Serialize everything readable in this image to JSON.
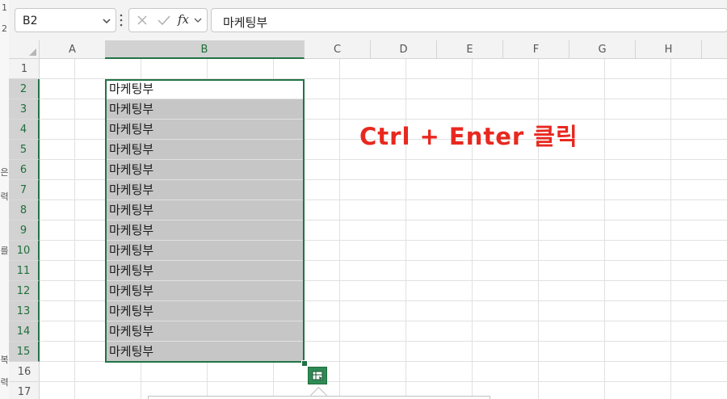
{
  "left_strip": {
    "chars": [
      "1",
      "2",
      "은",
      "력",
      "를",
      "복",
      "력"
    ]
  },
  "formula_bar": {
    "name_box_value": "B2",
    "fx_label": "fx",
    "formula_value": "마케팅부"
  },
  "sheet": {
    "columns": [
      "A",
      "B",
      "C",
      "D",
      "E",
      "F",
      "G",
      "H"
    ],
    "selected_column": "B",
    "rows": [
      "1",
      "2",
      "3",
      "4",
      "5",
      "6",
      "7",
      "8",
      "9",
      "10",
      "11",
      "12",
      "13",
      "14",
      "15",
      "16",
      "17"
    ],
    "selected_rows": [
      "2",
      "3",
      "4",
      "5",
      "6",
      "7",
      "8",
      "9",
      "10",
      "11",
      "12",
      "13",
      "14",
      "15"
    ],
    "active_cell": "B2",
    "b_values": [
      "마케팅부",
      "마케팅부",
      "마케팅부",
      "마케팅부",
      "마케팅부",
      "마케팅부",
      "마케팅부",
      "마케팅부",
      "마케팅부",
      "마케팅부",
      "마케팅부",
      "마케팅부",
      "마케팅부",
      "마케팅부"
    ]
  },
  "annotation": {
    "text": "Ctrl + Enter 클릭",
    "color": "#e8281f"
  },
  "colors": {
    "accent": "#217346",
    "selection_fill": "#c6c6c6"
  }
}
